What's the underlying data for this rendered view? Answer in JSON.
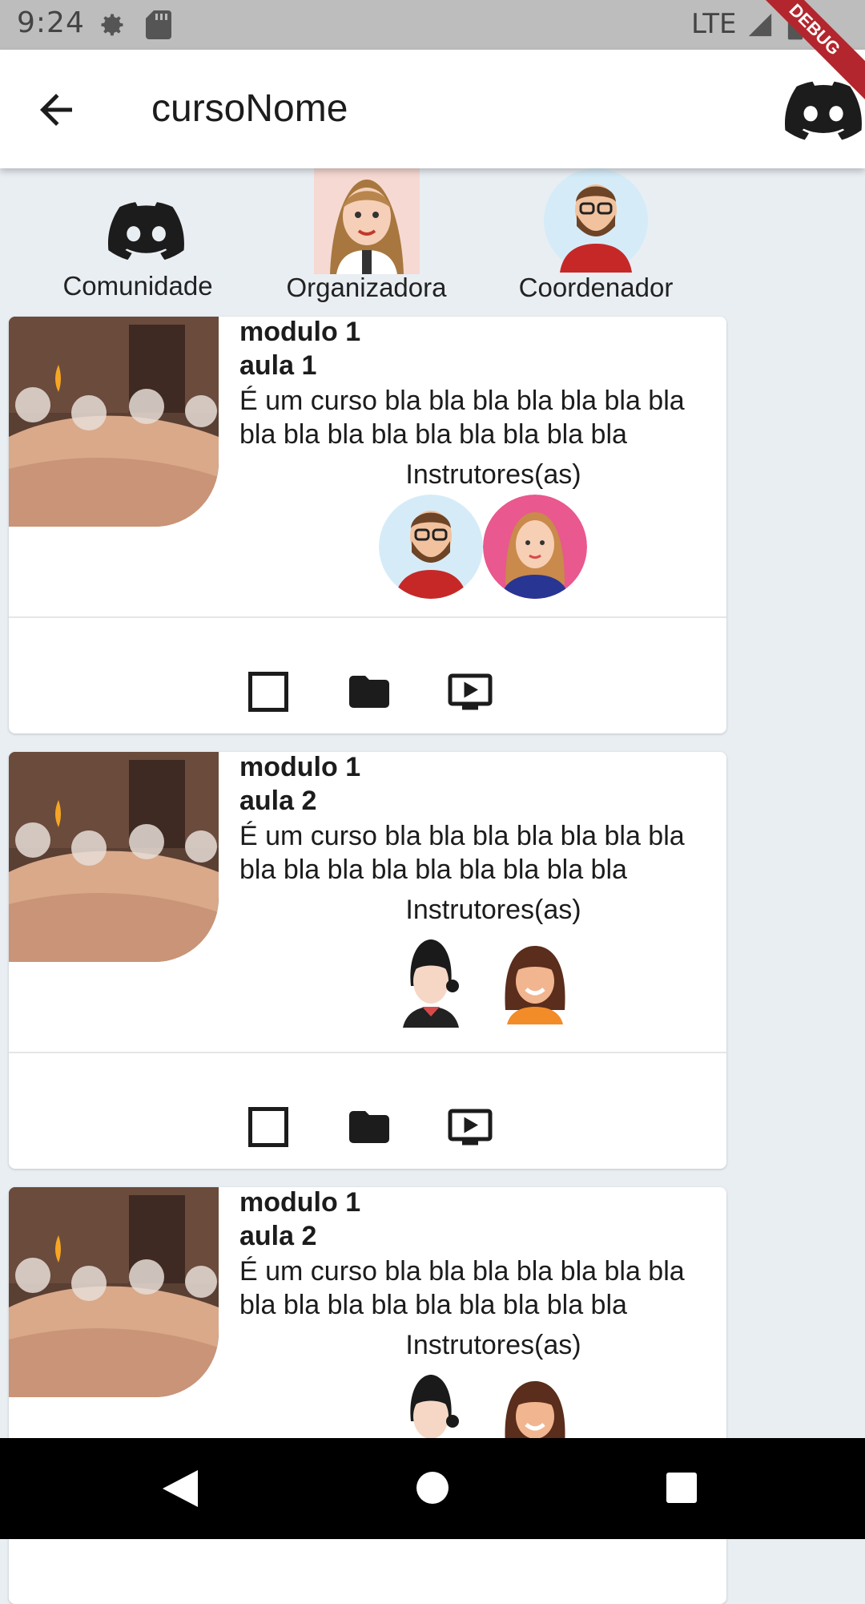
{
  "status_bar": {
    "time": "9:24",
    "network": "LTE",
    "debug_label": "DEBUG"
  },
  "app_bar": {
    "title": "cursoNome"
  },
  "top_links": [
    {
      "label": "Comunidade"
    },
    {
      "label": "Organizadora"
    },
    {
      "label": "Coordenador"
    }
  ],
  "cards": [
    {
      "module": "modulo 1",
      "lesson": "aula 1",
      "description": "É um curso bla bla bla bla bla bla bla bla bla bla bla bla bla bla bla bla",
      "instructors_label": "Instrutores(as)"
    },
    {
      "module": "modulo 1",
      "lesson": "aula 2",
      "description": "É um curso bla bla bla bla bla bla bla bla bla bla bla bla bla bla bla bla",
      "instructors_label": "Instrutores(as)"
    },
    {
      "module": "modulo 1",
      "lesson": "aula 2",
      "description": "É um curso bla bla bla bla bla bla bla bla bla bla bla bla bla bla bla bla",
      "instructors_label": "Instrutores(as)"
    }
  ],
  "icons": {
    "back": "arrow-left-icon",
    "discord": "discord-icon",
    "checkbox": "checkbox-outline-icon",
    "folder": "folder-icon",
    "video": "video-player-icon"
  },
  "colors": {
    "accent_red": "#b3262d",
    "page_bg": "#e9eef3",
    "pink_avatar_bg": "#e9588e",
    "light_blue_avatar_bg": "#d5ecf8"
  }
}
